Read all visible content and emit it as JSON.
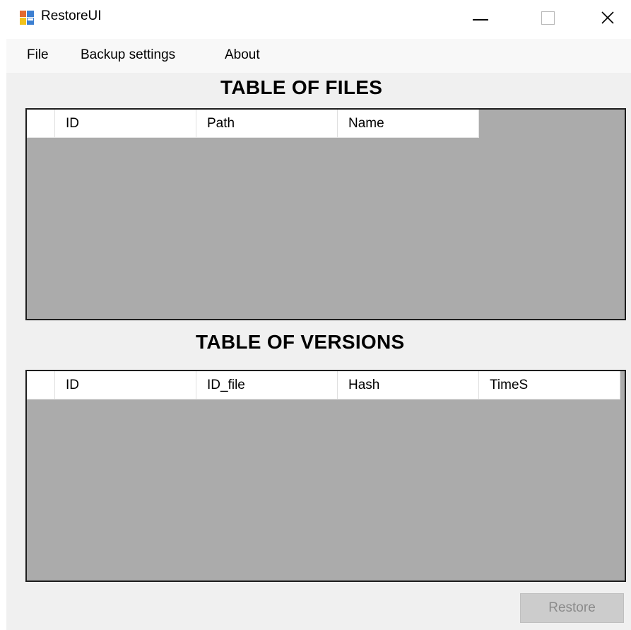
{
  "window": {
    "title": "RestoreUI",
    "icon": "application-window-icon"
  },
  "menu": {
    "items": [
      {
        "label": "File"
      },
      {
        "label": "Backup settings"
      },
      {
        "label": "About"
      }
    ]
  },
  "files_table": {
    "title": "TABLE OF FILES",
    "columns": [
      "ID",
      "Path",
      "Name"
    ],
    "rows": []
  },
  "versions_table": {
    "title": "TABLE OF VERSIONS",
    "columns": [
      "ID",
      "ID_file",
      "Hash",
      "TimeS"
    ],
    "rows": []
  },
  "actions": {
    "restore_label": "Restore",
    "restore_enabled": false
  },
  "colors": {
    "grid_background": "#ababab",
    "client_background": "#f0f0f0",
    "disabled_button": "#cccccc"
  }
}
